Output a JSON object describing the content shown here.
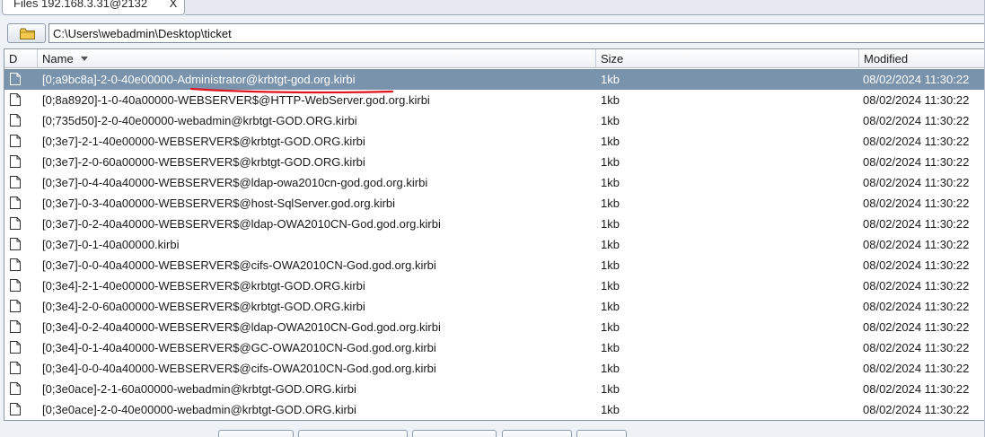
{
  "tab": {
    "title": "Files 192.168.3.31@2132",
    "close_label": "X"
  },
  "pathbar": {
    "path": "C:\\Users\\webadmin\\Desktop\\ticket"
  },
  "table": {
    "headers": {
      "d": "D",
      "name": "Name",
      "size": "Size",
      "modified": "Modified"
    },
    "rows": [
      {
        "name": "[0;a9bc8a]-2-0-40e00000-Administrator@krbtgt-god.org.kirbi",
        "size": "1kb",
        "modified": "08/02/2024 11:30:22",
        "selected": true
      },
      {
        "name": "[0;8a8920]-1-0-40a00000-WEBSERVER$@HTTP-WebServer.god.org.kirbi",
        "size": "1kb",
        "modified": "08/02/2024 11:30:22"
      },
      {
        "name": "[0;735d50]-2-0-40e00000-webadmin@krbtgt-GOD.ORG.kirbi",
        "size": "1kb",
        "modified": "08/02/2024 11:30:22"
      },
      {
        "name": "[0;3e7]-2-1-40e00000-WEBSERVER$@krbtgt-GOD.ORG.kirbi",
        "size": "1kb",
        "modified": "08/02/2024 11:30:22"
      },
      {
        "name": "[0;3e7]-2-0-60a00000-WEBSERVER$@krbtgt-GOD.ORG.kirbi",
        "size": "1kb",
        "modified": "08/02/2024 11:30:22"
      },
      {
        "name": "[0;3e7]-0-4-40a40000-WEBSERVER$@ldap-owa2010cn-god.god.org.kirbi",
        "size": "1kb",
        "modified": "08/02/2024 11:30:22"
      },
      {
        "name": "[0;3e7]-0-3-40a00000-WEBSERVER$@host-SqlServer.god.org.kirbi",
        "size": "1kb",
        "modified": "08/02/2024 11:30:22"
      },
      {
        "name": "[0;3e7]-0-2-40a40000-WEBSERVER$@ldap-OWA2010CN-God.god.org.kirbi",
        "size": "1kb",
        "modified": "08/02/2024 11:30:22"
      },
      {
        "name": "[0;3e7]-0-1-40a00000.kirbi",
        "size": "1kb",
        "modified": "08/02/2024 11:30:22"
      },
      {
        "name": "[0;3e7]-0-0-40a40000-WEBSERVER$@cifs-OWA2010CN-God.god.org.kirbi",
        "size": "1kb",
        "modified": "08/02/2024 11:30:22"
      },
      {
        "name": "[0;3e4]-2-1-40e00000-WEBSERVER$@krbtgt-GOD.ORG.kirbi",
        "size": "1kb",
        "modified": "08/02/2024 11:30:22"
      },
      {
        "name": "[0;3e4]-2-0-60a00000-WEBSERVER$@krbtgt-GOD.ORG.kirbi",
        "size": "1kb",
        "modified": "08/02/2024 11:30:22"
      },
      {
        "name": "[0;3e4]-0-2-40a40000-WEBSERVER$@ldap-OWA2010CN-God.god.org.kirbi",
        "size": "1kb",
        "modified": "08/02/2024 11:30:22"
      },
      {
        "name": "[0;3e4]-0-1-40a40000-WEBSERVER$@GC-OWA2010CN-God.god.org.kirbi",
        "size": "1kb",
        "modified": "08/02/2024 11:30:22"
      },
      {
        "name": "[0;3e4]-0-0-40a40000-WEBSERVER$@cifs-OWA2010CN-God.god.org.kirbi",
        "size": "1kb",
        "modified": "08/02/2024 11:30:22"
      },
      {
        "name": "[0;3e0ace]-2-1-60a00000-webadmin@krbtgt-GOD.ORG.kirbi",
        "size": "1kb",
        "modified": "08/02/2024 11:30:22"
      },
      {
        "name": "[0;3e0ace]-2-0-40e00000-webadmin@krbtgt-GOD.ORG.kirbi",
        "size": "1kb",
        "modified": "08/02/2024 11:30:22"
      }
    ]
  },
  "colors": {
    "selected_row": "#7a93ad",
    "underline_annotation": "#e0141c"
  }
}
